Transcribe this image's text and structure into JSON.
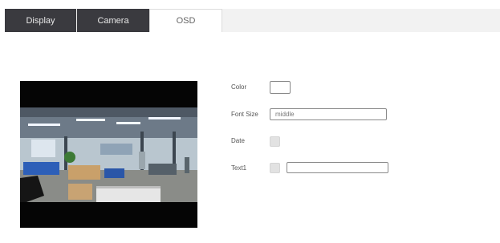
{
  "tabs": [
    {
      "label": "Display",
      "state": "inactive"
    },
    {
      "label": "Camera",
      "state": "inactive"
    },
    {
      "label": "OSD",
      "state": "active"
    }
  ],
  "form": {
    "color_label": "Color",
    "color_value": "#ffffff",
    "font_size_label": "Font Size",
    "font_size_value": "middle",
    "date_label": "Date",
    "date_checked": false,
    "text1_label": "Text1",
    "text1_checked": false,
    "text1_value": ""
  },
  "colors": {
    "tab_dark": "#3a3a3f",
    "tab_bar": "#f2f2f2",
    "checkbox": "#e2e2e2"
  }
}
